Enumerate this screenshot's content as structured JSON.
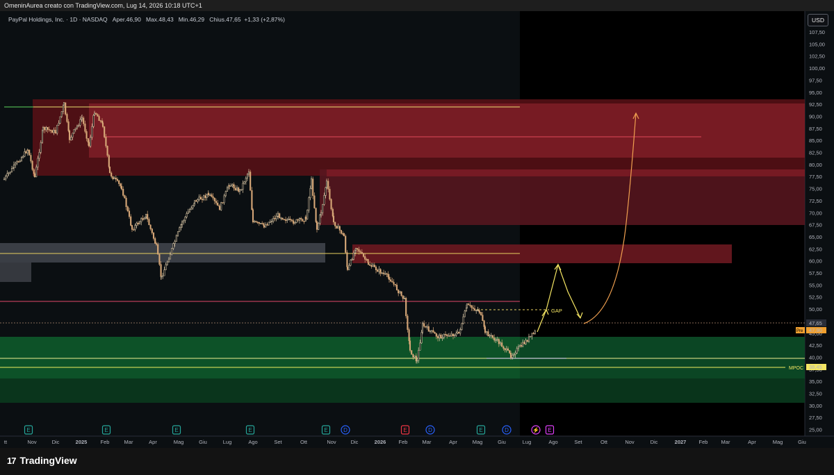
{
  "header": {
    "attribution": "OmeninAurea creato con TradingView.com, Lug 14, 2026 10:18 UTC+1"
  },
  "legend": {
    "symbol": "PayPal Holdings, Inc. · 1D · NASDAQ",
    "open_label": "O",
    "open": "Aper.46,90",
    "high_label": "H",
    "high": "Max.48,43",
    "low_label": "L",
    "low": "Min.46,29",
    "close_label": "C",
    "close": "Chius.47,65",
    "change": "+1,33 (+2,87%)"
  },
  "currency_button": "USD",
  "price_axis": {
    "ticks": [
      "107,50",
      "105,00",
      "102,50",
      "100,00",
      "97,50",
      "95,00",
      "92,50",
      "90,00",
      "87,50",
      "85,00",
      "82,50",
      "80,00",
      "77,50",
      "75,00",
      "72,50",
      "70,00",
      "67,50",
      "65,00",
      "62,50",
      "60,00",
      "57,50",
      "55,00",
      "52,50",
      "50,00",
      "47,50",
      "45,00",
      "42,50",
      "40,00",
      "37,50",
      "35,00",
      "32,50",
      "30,00",
      "27,50",
      "25,00"
    ],
    "last_price": "47,65",
    "pre_badge": "Pre",
    "pre_price": "47,90",
    "mpoc_label": "MPOC",
    "mpoc_value": "38,45"
  },
  "time_axis": {
    "ticks": [
      "tt",
      "Nov",
      "Dic",
      "2025",
      "Feb",
      "Mar",
      "Apr",
      "Mag",
      "Giu",
      "Lug",
      "Ago",
      "Set",
      "Ott",
      "Nov",
      "Dic",
      "2026",
      "Feb",
      "Mar",
      "Apr",
      "Mag",
      "Giu",
      "Lug",
      "Ago",
      "Set",
      "Ott",
      "Nov",
      "Dic",
      "2027",
      "Feb",
      "Mar",
      "Apr",
      "Mag",
      "Giu"
    ],
    "bold": [
      "2025",
      "2026",
      "2027"
    ]
  },
  "annotations": {
    "gap_label": "GAP"
  },
  "events": [
    {
      "letter": "E",
      "color": "#26a69a"
    },
    {
      "letter": "E",
      "color": "#26a69a"
    },
    {
      "letter": "E",
      "color": "#26a69a"
    },
    {
      "letter": "E",
      "color": "#26a69a"
    },
    {
      "letter": "E",
      "color": "#26a69a"
    },
    {
      "letter": "D",
      "color": "#2962ff"
    },
    {
      "letter": "E",
      "color": "#f23645"
    },
    {
      "letter": "D",
      "color": "#2962ff"
    },
    {
      "letter": "E",
      "color": "#26a69a"
    },
    {
      "letter": "D",
      "color": "#2962ff"
    },
    {
      "letter": "⚡",
      "color": "#e040fb"
    },
    {
      "letter": "E",
      "color": "#e040fb"
    }
  ],
  "branding": {
    "logo_mark": "17",
    "logo_text": "TradingView"
  },
  "colors": {
    "up_candle": "#e8c9a0",
    "down_candle": "#e8c9a0",
    "resistance_zone": "#8b1c24",
    "support_zone": "#0e5a2c",
    "projection": "#f5c542",
    "accent_yellow": "#f5e663"
  }
}
